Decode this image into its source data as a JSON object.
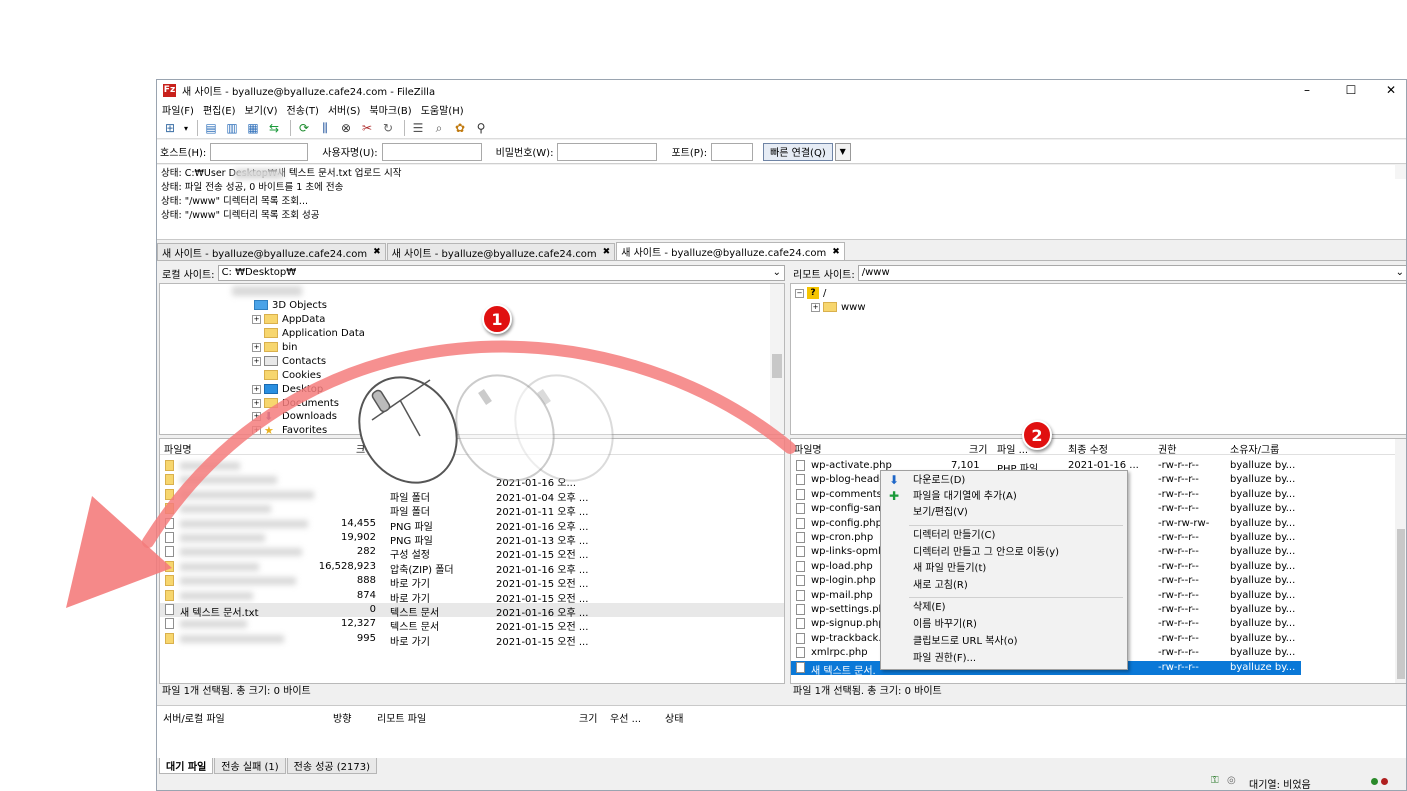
{
  "window": {
    "title": "새 사이트 - byalluze@byalluze.cafe24.com - FileZilla",
    "minimize": "–",
    "maximize": "☐",
    "close": "✕"
  },
  "menu": [
    "파일(F)",
    "편집(E)",
    "보기(V)",
    "전송(T)",
    "서버(S)",
    "북마크(B)",
    "도움말(H)"
  ],
  "quickconnect": {
    "host_label": "호스트(H):",
    "user_label": "사용자명(U):",
    "pass_label": "비밀번호(W):",
    "port_label": "포트(P):",
    "button": "빠른 연결(Q)"
  },
  "log": [
    "상태:  C:₩User          Desktop₩새 텍스트 문서.txt 업로드 시작",
    "상태:  파일 전송 성공, 0 바이트를 1 초에 전송",
    "상태:  \"/www\" 디렉터리 목록 조회...",
    "상태:  \"/www\" 디렉터리 목록 조회 성공"
  ],
  "tabs": [
    "새 사이트 - byalluze@byalluze.cafe24.com",
    "새 사이트 - byalluze@byalluze.cafe24.com",
    "새 사이트 - byalluze@byalluze.cafe24.com"
  ],
  "local": {
    "site_label": "로컬 사이트:",
    "path": "C:               ₩Desktop₩",
    "tree": [
      "3D Objects",
      "AppData",
      "Application Data",
      "bin",
      "Contacts",
      "Cookies",
      "Desktop",
      "Documents",
      "Downloads",
      "Favorites"
    ],
    "columns": {
      "name": "파일명",
      "size": "크"
    },
    "files": [
      {
        "name": "",
        "size": "",
        "type": "",
        "modified": ""
      },
      {
        "name": "",
        "size": "",
        "type": "",
        "modified": "2021-01-16 오..."
      },
      {
        "name": "",
        "size": "",
        "type": "파일 폴더",
        "modified": "2021-01-04 오후 ..."
      },
      {
        "name": "",
        "size": "",
        "type": "파일 폴더",
        "modified": "2021-01-11 오후 ..."
      },
      {
        "name": "",
        "size": "14,455",
        "type": "PNG 파일",
        "modified": "2021-01-16 오후 ..."
      },
      {
        "name": "",
        "size": "19,902",
        "type": "PNG 파일",
        "modified": "2021-01-13 오후 ..."
      },
      {
        "name": "",
        "size": "282",
        "type": "구성 설정",
        "modified": "2021-01-15 오전 ..."
      },
      {
        "name": "",
        "size": "16,528,923",
        "type": "압축(ZIP) 폴더",
        "modified": "2021-01-16 오후 ..."
      },
      {
        "name": "",
        "size": "888",
        "type": "바로 가기",
        "modified": "2021-01-15 오전 ..."
      },
      {
        "name": "",
        "size": "874",
        "type": "바로 가기",
        "modified": "2021-01-15 오전 ..."
      },
      {
        "name": "새 텍스트 문서.txt",
        "size": "0",
        "type": "텍스트 문서",
        "modified": "2021-01-16 오후 ..."
      },
      {
        "name": "",
        "size": "12,327",
        "type": "텍스트 문서",
        "modified": "2021-01-15 오전 ..."
      },
      {
        "name": "",
        "size": "995",
        "type": "바로 가기",
        "modified": "2021-01-15 오전 ..."
      }
    ],
    "status": "파일 1개 선택됨. 총 크기: 0 바이트"
  },
  "remote": {
    "site_label": "리모트 사이트:",
    "path": "/www",
    "tree": [
      "/",
      "www"
    ],
    "columns": {
      "name": "파일명",
      "size": "크기",
      "type": "파일 ...",
      "modified": "최종 수정",
      "perm": "권한",
      "owner": "소유자/그룹"
    },
    "files": [
      {
        "name": "wp-activate.php",
        "size": "7,101",
        "type": "PHP 파일",
        "modified": "2021-01-16 ...",
        "perm": "-rw-r--r--",
        "owner": "byalluze by..."
      },
      {
        "name": "wp-blog-heade",
        "perm": "-rw-r--r--",
        "owner": "byalluze by..."
      },
      {
        "name": "wp-comments-",
        "perm": "-rw-r--r--",
        "owner": "byalluze by..."
      },
      {
        "name": "wp-config-sam",
        "perm": "-rw-r--r--",
        "owner": "byalluze by..."
      },
      {
        "name": "wp-config.php",
        "perm": "-rw-rw-rw-",
        "owner": "byalluze by..."
      },
      {
        "name": "wp-cron.php",
        "perm": "-rw-r--r--",
        "owner": "byalluze by..."
      },
      {
        "name": "wp-links-opml.",
        "perm": "-rw-r--r--",
        "owner": "byalluze by..."
      },
      {
        "name": "wp-load.php",
        "perm": "-rw-r--r--",
        "owner": "byalluze by..."
      },
      {
        "name": "wp-login.php",
        "perm": "-rw-r--r--",
        "owner": "byalluze by..."
      },
      {
        "name": "wp-mail.php",
        "perm": "-rw-r--r--",
        "owner": "byalluze by..."
      },
      {
        "name": "wp-settings.ph",
        "perm": "-rw-r--r--",
        "owner": "byalluze by..."
      },
      {
        "name": "wp-signup.php",
        "perm": "-rw-r--r--",
        "owner": "byalluze by..."
      },
      {
        "name": "wp-trackback.p",
        "perm": "-rw-r--r--",
        "owner": "byalluze by..."
      },
      {
        "name": "xmlrpc.php",
        "perm": "-rw-r--r--",
        "owner": "byalluze by..."
      },
      {
        "name": "새 텍스트 문서.",
        "perm": "-rw-r--r--",
        "owner": "byalluze by..."
      }
    ],
    "status": "파일 1개 선택됨. 총 크기: 0 바이트"
  },
  "context_menu": [
    "다운로드(D)",
    "파일을 대기열에 추가(A)",
    "보기/편집(V)",
    "디렉터리 만들기(C)",
    "디렉터리 만들고 그 안으로 이동(y)",
    "새 파일 만들기(t)",
    "새로 고침(R)",
    "삭제(E)",
    "이름 바꾸기(R)",
    "클립보드로 URL 복사(o)",
    "파일 권한(F)..."
  ],
  "queue": {
    "columns": [
      "서버/로컬 파일",
      "방향",
      "리모트 파일",
      "크기",
      "우선 ...",
      "상태"
    ],
    "tabs": [
      "대기 파일",
      "전송 실패 (1)",
      "전송 성공 (2173)"
    ],
    "status": "대기열: 비었음"
  },
  "annotations": {
    "badge1": "1",
    "badge2": "2",
    "arrow_color": "#f47c7c"
  }
}
